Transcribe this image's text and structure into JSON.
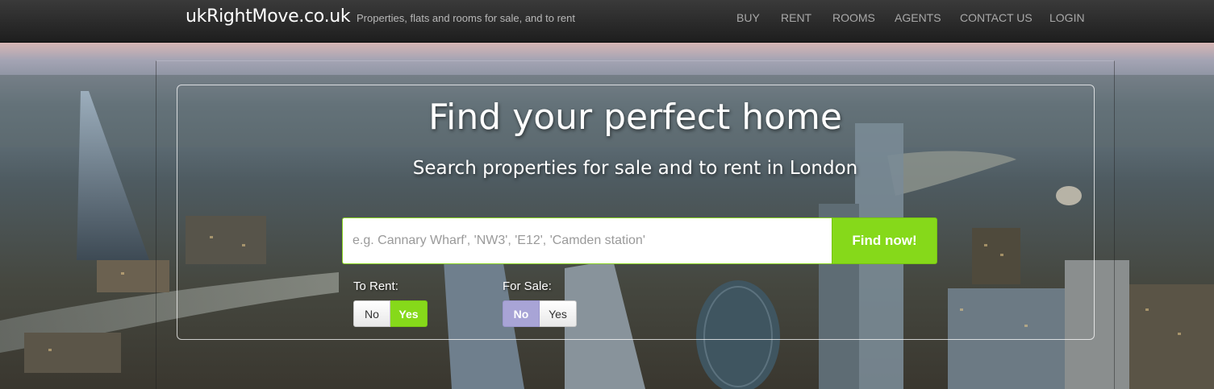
{
  "header": {
    "brand": "ukRightMove.co.uk",
    "tagline": "Properties, flats and rooms for sale, and to rent",
    "nav": [
      "BUY",
      "RENT",
      "ROOMS",
      "AGENTS",
      "CONTACT US",
      "LOGIN"
    ]
  },
  "hero": {
    "headline": "Find your perfect home",
    "subheadline": "Search properties for sale and to rent in London"
  },
  "search": {
    "placeholder": "e.g. Cannary Wharf', 'NW3', 'E12', 'Camden station'",
    "value": "",
    "button_label": "Find now!"
  },
  "filters": {
    "rent": {
      "label": "To Rent:",
      "no_label": "No",
      "yes_label": "Yes",
      "selected": "Yes"
    },
    "sale": {
      "label": "For Sale:",
      "no_label": "No",
      "yes_label": "Yes",
      "selected": "No"
    }
  },
  "colors": {
    "accent_green": "#86d91a",
    "selected_purple": "#a8a4d6",
    "navbar": "#2a2a2a"
  }
}
